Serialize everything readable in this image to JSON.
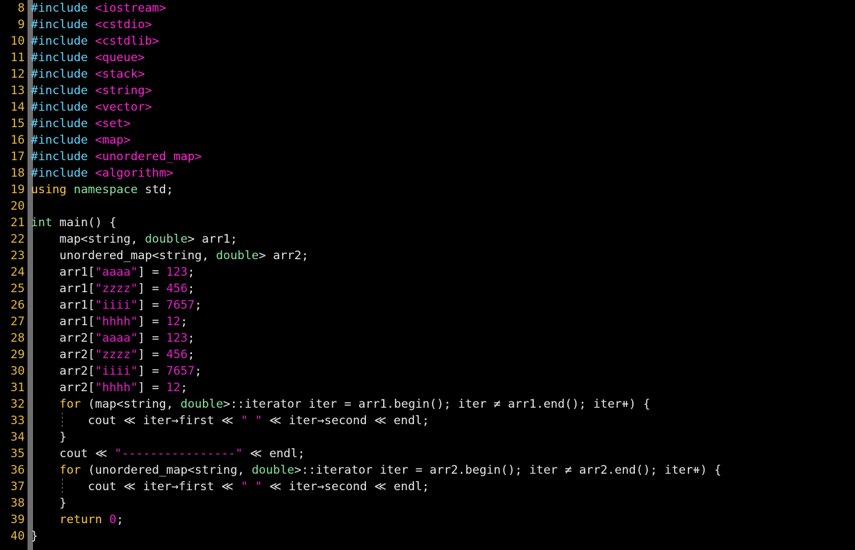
{
  "editor": {
    "language": "C++",
    "background_color": "#000000",
    "gutter_bar_color": "#6e6e6e",
    "line_number_color": "#e5b93c",
    "first_visible_line": 8,
    "last_visible_line": 40,
    "palette": {
      "plain": "#e8e8e8",
      "preprocessor": "#5fd7ff",
      "header": "#ff22d4",
      "keyword": "#ffc83c",
      "type": "#87e3a0",
      "string": "#e61fc8",
      "number": "#e61fc8"
    }
  },
  "lines": [
    {
      "n": "8",
      "indent_guide": false,
      "tokens": [
        {
          "t": "#include ",
          "c": "pre"
        },
        {
          "t": "<iostream>",
          "c": "hdr"
        }
      ]
    },
    {
      "n": "9",
      "indent_guide": false,
      "tokens": [
        {
          "t": "#include ",
          "c": "pre"
        },
        {
          "t": "<cstdio>",
          "c": "hdr"
        }
      ]
    },
    {
      "n": "10",
      "indent_guide": false,
      "tokens": [
        {
          "t": "#include ",
          "c": "pre"
        },
        {
          "t": "<cstdlib>",
          "c": "hdr"
        }
      ]
    },
    {
      "n": "11",
      "indent_guide": false,
      "tokens": [
        {
          "t": "#include ",
          "c": "pre"
        },
        {
          "t": "<queue>",
          "c": "hdr"
        }
      ]
    },
    {
      "n": "12",
      "indent_guide": false,
      "tokens": [
        {
          "t": "#include ",
          "c": "pre"
        },
        {
          "t": "<stack>",
          "c": "hdr"
        }
      ]
    },
    {
      "n": "13",
      "indent_guide": false,
      "tokens": [
        {
          "t": "#include ",
          "c": "pre"
        },
        {
          "t": "<string>",
          "c": "hdr"
        }
      ]
    },
    {
      "n": "14",
      "indent_guide": false,
      "tokens": [
        {
          "t": "#include ",
          "c": "pre"
        },
        {
          "t": "<vector>",
          "c": "hdr"
        }
      ]
    },
    {
      "n": "15",
      "indent_guide": false,
      "tokens": [
        {
          "t": "#include ",
          "c": "pre"
        },
        {
          "t": "<set>",
          "c": "hdr"
        }
      ]
    },
    {
      "n": "16",
      "indent_guide": false,
      "tokens": [
        {
          "t": "#include ",
          "c": "pre"
        },
        {
          "t": "<map>",
          "c": "hdr"
        }
      ]
    },
    {
      "n": "17",
      "indent_guide": false,
      "tokens": [
        {
          "t": "#include ",
          "c": "pre"
        },
        {
          "t": "<unordered_map>",
          "c": "hdr"
        }
      ]
    },
    {
      "n": "18",
      "indent_guide": false,
      "tokens": [
        {
          "t": "#include ",
          "c": "pre"
        },
        {
          "t": "<algorithm>",
          "c": "hdr"
        }
      ]
    },
    {
      "n": "19",
      "indent_guide": false,
      "tokens": [
        {
          "t": "using",
          "c": "kw"
        },
        {
          "t": " ",
          "c": "plain"
        },
        {
          "t": "namespace",
          "c": "type"
        },
        {
          "t": " std;",
          "c": "plain"
        }
      ]
    },
    {
      "n": "20",
      "indent_guide": false,
      "tokens": []
    },
    {
      "n": "21",
      "indent_guide": false,
      "tokens": [
        {
          "t": "int",
          "c": "type"
        },
        {
          "t": " main() {",
          "c": "plain"
        }
      ]
    },
    {
      "n": "22",
      "indent_guide": false,
      "tokens": [
        {
          "t": "    map<string, ",
          "c": "plain"
        },
        {
          "t": "double",
          "c": "type"
        },
        {
          "t": "> arr1;",
          "c": "plain"
        }
      ]
    },
    {
      "n": "23",
      "indent_guide": false,
      "tokens": [
        {
          "t": "    unordered_map<string, ",
          "c": "plain"
        },
        {
          "t": "double",
          "c": "type"
        },
        {
          "t": "> arr2;",
          "c": "plain"
        }
      ]
    },
    {
      "n": "24",
      "indent_guide": false,
      "tokens": [
        {
          "t": "    arr1[",
          "c": "plain"
        },
        {
          "t": "\"aaaa\"",
          "c": "str"
        },
        {
          "t": "] = ",
          "c": "plain"
        },
        {
          "t": "123",
          "c": "num"
        },
        {
          "t": ";",
          "c": "plain"
        }
      ]
    },
    {
      "n": "25",
      "indent_guide": false,
      "tokens": [
        {
          "t": "    arr1[",
          "c": "plain"
        },
        {
          "t": "\"zzzz\"",
          "c": "str"
        },
        {
          "t": "] = ",
          "c": "plain"
        },
        {
          "t": "456",
          "c": "num"
        },
        {
          "t": ";",
          "c": "plain"
        }
      ]
    },
    {
      "n": "26",
      "indent_guide": false,
      "tokens": [
        {
          "t": "    arr1[",
          "c": "plain"
        },
        {
          "t": "\"iiii\"",
          "c": "str"
        },
        {
          "t": "] = ",
          "c": "plain"
        },
        {
          "t": "7657",
          "c": "num"
        },
        {
          "t": ";",
          "c": "plain"
        }
      ]
    },
    {
      "n": "27",
      "indent_guide": false,
      "tokens": [
        {
          "t": "    arr1[",
          "c": "plain"
        },
        {
          "t": "\"hhhh\"",
          "c": "str"
        },
        {
          "t": "] = ",
          "c": "plain"
        },
        {
          "t": "12",
          "c": "num"
        },
        {
          "t": ";",
          "c": "plain"
        }
      ]
    },
    {
      "n": "28",
      "indent_guide": false,
      "tokens": [
        {
          "t": "    arr2[",
          "c": "plain"
        },
        {
          "t": "\"aaaa\"",
          "c": "str"
        },
        {
          "t": "] = ",
          "c": "plain"
        },
        {
          "t": "123",
          "c": "num"
        },
        {
          "t": ";",
          "c": "plain"
        }
      ]
    },
    {
      "n": "29",
      "indent_guide": false,
      "tokens": [
        {
          "t": "    arr2[",
          "c": "plain"
        },
        {
          "t": "\"zzzz\"",
          "c": "str"
        },
        {
          "t": "] = ",
          "c": "plain"
        },
        {
          "t": "456",
          "c": "num"
        },
        {
          "t": ";",
          "c": "plain"
        }
      ]
    },
    {
      "n": "30",
      "indent_guide": false,
      "tokens": [
        {
          "t": "    arr2[",
          "c": "plain"
        },
        {
          "t": "\"iiii\"",
          "c": "str"
        },
        {
          "t": "] = ",
          "c": "plain"
        },
        {
          "t": "7657",
          "c": "num"
        },
        {
          "t": ";",
          "c": "plain"
        }
      ]
    },
    {
      "n": "31",
      "indent_guide": false,
      "tokens": [
        {
          "t": "    arr2[",
          "c": "plain"
        },
        {
          "t": "\"hhhh\"",
          "c": "str"
        },
        {
          "t": "] = ",
          "c": "plain"
        },
        {
          "t": "12",
          "c": "num"
        },
        {
          "t": ";",
          "c": "plain"
        }
      ]
    },
    {
      "n": "32",
      "indent_guide": false,
      "tokens": [
        {
          "t": "    ",
          "c": "plain"
        },
        {
          "t": "for",
          "c": "kw"
        },
        {
          "t": " (map<string, ",
          "c": "plain"
        },
        {
          "t": "double",
          "c": "type"
        },
        {
          "t": ">::iterator iter = arr1.begin(); iter ≠ arr1.end(); iter⧺) {",
          "c": "plain"
        }
      ]
    },
    {
      "n": "33",
      "indent_guide": true,
      "tokens": [
        {
          "t": "        cout ≪ iter→first ≪ ",
          "c": "plain"
        },
        {
          "t": "\" \"",
          "c": "str"
        },
        {
          "t": " ≪ iter→second ≪ endl;",
          "c": "plain"
        }
      ]
    },
    {
      "n": "34",
      "indent_guide": false,
      "tokens": [
        {
          "t": "    }",
          "c": "plain"
        }
      ]
    },
    {
      "n": "35",
      "indent_guide": false,
      "tokens": [
        {
          "t": "    cout ≪ ",
          "c": "plain"
        },
        {
          "t": "\"----------------\"",
          "c": "str"
        },
        {
          "t": " ≪ endl;",
          "c": "plain"
        }
      ]
    },
    {
      "n": "36",
      "indent_guide": false,
      "tokens": [
        {
          "t": "    ",
          "c": "plain"
        },
        {
          "t": "for",
          "c": "kw"
        },
        {
          "t": " (unordered_map<string, ",
          "c": "plain"
        },
        {
          "t": "double",
          "c": "type"
        },
        {
          "t": ">::iterator iter = arr2.begin(); iter ≠ arr2.end(); iter⧺) {",
          "c": "plain"
        }
      ]
    },
    {
      "n": "37",
      "indent_guide": true,
      "tokens": [
        {
          "t": "        cout ≪ iter→first ≪ ",
          "c": "plain"
        },
        {
          "t": "\" \"",
          "c": "str"
        },
        {
          "t": " ≪ iter→second ≪ endl;",
          "c": "plain"
        }
      ]
    },
    {
      "n": "38",
      "indent_guide": false,
      "tokens": [
        {
          "t": "    }",
          "c": "plain"
        }
      ]
    },
    {
      "n": "39",
      "indent_guide": false,
      "tokens": [
        {
          "t": "    ",
          "c": "plain"
        },
        {
          "t": "return",
          "c": "kw"
        },
        {
          "t": " ",
          "c": "plain"
        },
        {
          "t": "0",
          "c": "num"
        },
        {
          "t": ";",
          "c": "plain"
        }
      ]
    },
    {
      "n": "40",
      "indent_guide": false,
      "tokens": [
        {
          "t": "}",
          "c": "plain"
        }
      ]
    }
  ]
}
